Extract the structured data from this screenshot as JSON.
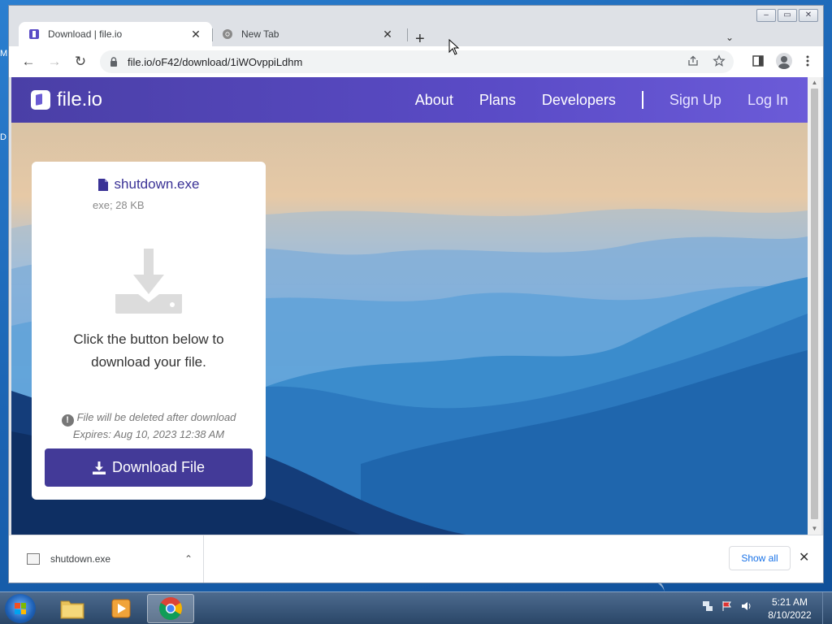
{
  "desktop": {
    "icon_label_1": "M",
    "icon_label_2": "D"
  },
  "browser": {
    "tabs": [
      {
        "title": "Download | file.io",
        "close": "✕"
      },
      {
        "title": "New Tab",
        "close": "✕"
      }
    ],
    "new_tab": "+",
    "tab_menu": "⌄",
    "window_controls": {
      "minimize": "–",
      "restore": "▭",
      "close": "✕"
    },
    "nav": {
      "back": "←",
      "forward": "→",
      "reload": "↻"
    },
    "url": "file.io/oF42/download/1iWOvppiLdhm"
  },
  "site": {
    "logo_text": "file.io",
    "nav": {
      "about": "About",
      "plans": "Plans",
      "developers": "Developers",
      "signup": "Sign Up",
      "login": "Log In"
    },
    "card": {
      "file_name": "shutdown.exe",
      "file_meta": "exe; 28 KB",
      "instruction": "Click the button below to download your file.",
      "notice_line1": "File will be deleted after download",
      "notice_line2": "Expires: Aug 10, 2023 12:38 AM",
      "button": "Download File"
    },
    "colors": {
      "header": "#4a3fa6",
      "button": "#433a98"
    }
  },
  "download_bar": {
    "item_name": "shutdown.exe",
    "chevron": "⌃",
    "show_all": "Show all",
    "close": "✕"
  },
  "taskbar": {
    "time": "5:21 AM",
    "date": "8/10/2022"
  }
}
